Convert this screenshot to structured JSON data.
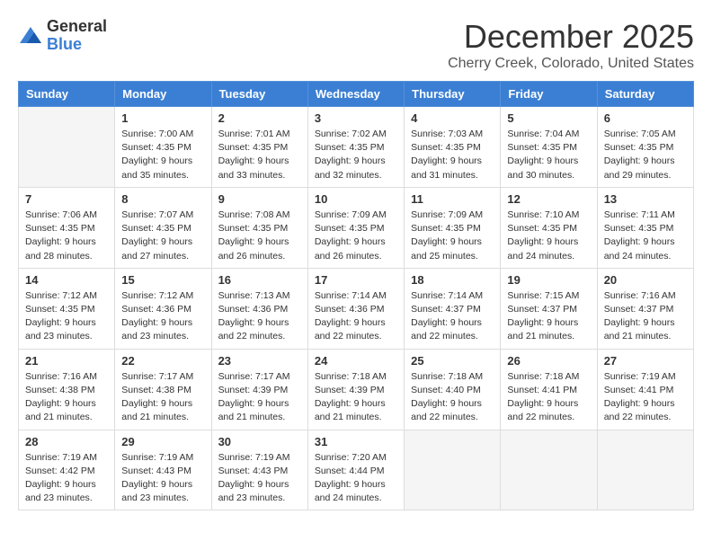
{
  "header": {
    "logo_general": "General",
    "logo_blue": "Blue",
    "month_title": "December 2025",
    "location": "Cherry Creek, Colorado, United States"
  },
  "days_of_week": [
    "Sunday",
    "Monday",
    "Tuesday",
    "Wednesday",
    "Thursday",
    "Friday",
    "Saturday"
  ],
  "weeks": [
    [
      {
        "day": "",
        "info": ""
      },
      {
        "day": "1",
        "info": "Sunrise: 7:00 AM\nSunset: 4:35 PM\nDaylight: 9 hours\nand 35 minutes."
      },
      {
        "day": "2",
        "info": "Sunrise: 7:01 AM\nSunset: 4:35 PM\nDaylight: 9 hours\nand 33 minutes."
      },
      {
        "day": "3",
        "info": "Sunrise: 7:02 AM\nSunset: 4:35 PM\nDaylight: 9 hours\nand 32 minutes."
      },
      {
        "day": "4",
        "info": "Sunrise: 7:03 AM\nSunset: 4:35 PM\nDaylight: 9 hours\nand 31 minutes."
      },
      {
        "day": "5",
        "info": "Sunrise: 7:04 AM\nSunset: 4:35 PM\nDaylight: 9 hours\nand 30 minutes."
      },
      {
        "day": "6",
        "info": "Sunrise: 7:05 AM\nSunset: 4:35 PM\nDaylight: 9 hours\nand 29 minutes."
      }
    ],
    [
      {
        "day": "7",
        "info": "Sunrise: 7:06 AM\nSunset: 4:35 PM\nDaylight: 9 hours\nand 28 minutes."
      },
      {
        "day": "8",
        "info": "Sunrise: 7:07 AM\nSunset: 4:35 PM\nDaylight: 9 hours\nand 27 minutes."
      },
      {
        "day": "9",
        "info": "Sunrise: 7:08 AM\nSunset: 4:35 PM\nDaylight: 9 hours\nand 26 minutes."
      },
      {
        "day": "10",
        "info": "Sunrise: 7:09 AM\nSunset: 4:35 PM\nDaylight: 9 hours\nand 26 minutes."
      },
      {
        "day": "11",
        "info": "Sunrise: 7:09 AM\nSunset: 4:35 PM\nDaylight: 9 hours\nand 25 minutes."
      },
      {
        "day": "12",
        "info": "Sunrise: 7:10 AM\nSunset: 4:35 PM\nDaylight: 9 hours\nand 24 minutes."
      },
      {
        "day": "13",
        "info": "Sunrise: 7:11 AM\nSunset: 4:35 PM\nDaylight: 9 hours\nand 24 minutes."
      }
    ],
    [
      {
        "day": "14",
        "info": "Sunrise: 7:12 AM\nSunset: 4:35 PM\nDaylight: 9 hours\nand 23 minutes."
      },
      {
        "day": "15",
        "info": "Sunrise: 7:12 AM\nSunset: 4:36 PM\nDaylight: 9 hours\nand 23 minutes."
      },
      {
        "day": "16",
        "info": "Sunrise: 7:13 AM\nSunset: 4:36 PM\nDaylight: 9 hours\nand 22 minutes."
      },
      {
        "day": "17",
        "info": "Sunrise: 7:14 AM\nSunset: 4:36 PM\nDaylight: 9 hours\nand 22 minutes."
      },
      {
        "day": "18",
        "info": "Sunrise: 7:14 AM\nSunset: 4:37 PM\nDaylight: 9 hours\nand 22 minutes."
      },
      {
        "day": "19",
        "info": "Sunrise: 7:15 AM\nSunset: 4:37 PM\nDaylight: 9 hours\nand 21 minutes."
      },
      {
        "day": "20",
        "info": "Sunrise: 7:16 AM\nSunset: 4:37 PM\nDaylight: 9 hours\nand 21 minutes."
      }
    ],
    [
      {
        "day": "21",
        "info": "Sunrise: 7:16 AM\nSunset: 4:38 PM\nDaylight: 9 hours\nand 21 minutes."
      },
      {
        "day": "22",
        "info": "Sunrise: 7:17 AM\nSunset: 4:38 PM\nDaylight: 9 hours\nand 21 minutes."
      },
      {
        "day": "23",
        "info": "Sunrise: 7:17 AM\nSunset: 4:39 PM\nDaylight: 9 hours\nand 21 minutes."
      },
      {
        "day": "24",
        "info": "Sunrise: 7:18 AM\nSunset: 4:39 PM\nDaylight: 9 hours\nand 21 minutes."
      },
      {
        "day": "25",
        "info": "Sunrise: 7:18 AM\nSunset: 4:40 PM\nDaylight: 9 hours\nand 22 minutes."
      },
      {
        "day": "26",
        "info": "Sunrise: 7:18 AM\nSunset: 4:41 PM\nDaylight: 9 hours\nand 22 minutes."
      },
      {
        "day": "27",
        "info": "Sunrise: 7:19 AM\nSunset: 4:41 PM\nDaylight: 9 hours\nand 22 minutes."
      }
    ],
    [
      {
        "day": "28",
        "info": "Sunrise: 7:19 AM\nSunset: 4:42 PM\nDaylight: 9 hours\nand 23 minutes."
      },
      {
        "day": "29",
        "info": "Sunrise: 7:19 AM\nSunset: 4:43 PM\nDaylight: 9 hours\nand 23 minutes."
      },
      {
        "day": "30",
        "info": "Sunrise: 7:19 AM\nSunset: 4:43 PM\nDaylight: 9 hours\nand 23 minutes."
      },
      {
        "day": "31",
        "info": "Sunrise: 7:20 AM\nSunset: 4:44 PM\nDaylight: 9 hours\nand 24 minutes."
      },
      {
        "day": "",
        "info": ""
      },
      {
        "day": "",
        "info": ""
      },
      {
        "day": "",
        "info": ""
      }
    ]
  ]
}
